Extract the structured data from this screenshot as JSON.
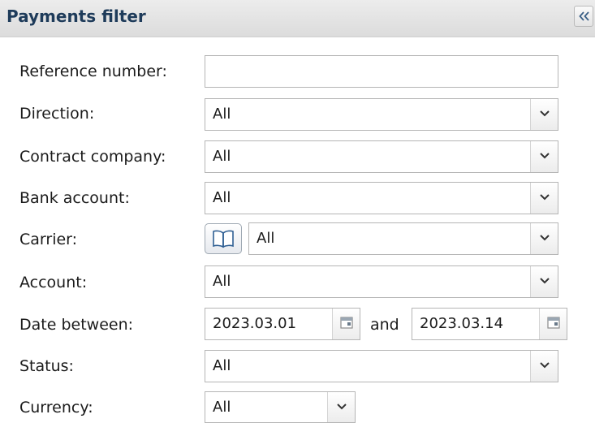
{
  "panel": {
    "title": "Payments filter",
    "collapse_icon": "double-chevron-left-icon"
  },
  "fields": {
    "reference_number": {
      "label": "Reference number:",
      "value": "",
      "placeholder": ""
    },
    "direction": {
      "label": "Direction:",
      "value": "All"
    },
    "contract_company": {
      "label": "Contract company:",
      "value": "All"
    },
    "bank_account": {
      "label": "Bank account:",
      "value": "All"
    },
    "carrier": {
      "label": "Carrier:",
      "value": "All",
      "lookup_icon": "book-icon"
    },
    "account": {
      "label": "Account:",
      "value": "All"
    },
    "date_between": {
      "label": "Date between:",
      "from": "2023.03.01",
      "separator": "and",
      "to": "2023.03.14",
      "calendar_icon": "calendar-icon"
    },
    "status": {
      "label": "Status:",
      "value": "All"
    },
    "currency": {
      "label": "Currency:",
      "value": "All"
    }
  },
  "icons": {
    "dropdown": "chevron-down-icon"
  },
  "colors": {
    "title_text": "#1e3b5a",
    "header_bg": "#e4e4e4",
    "field_border": "#b5b5b5"
  }
}
